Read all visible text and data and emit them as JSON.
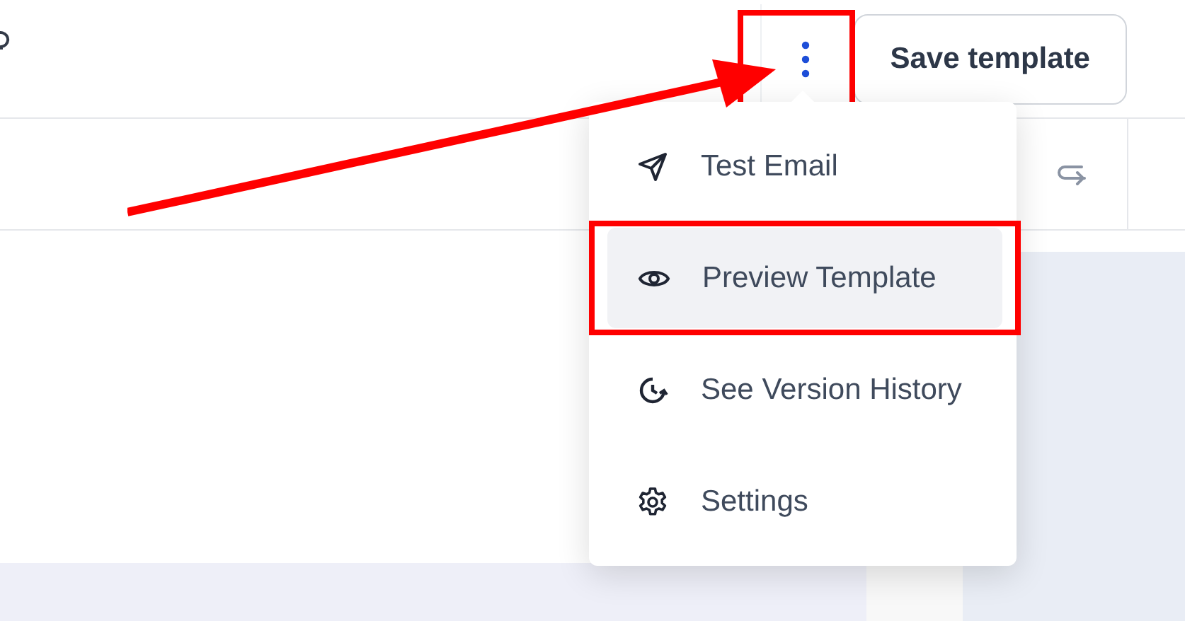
{
  "more_button": {
    "highlighted": true
  },
  "save_button": {
    "label": "Save template"
  },
  "menu": {
    "items": [
      {
        "kind": "send",
        "label": "Test Email",
        "selected": false,
        "highlighted": false
      },
      {
        "kind": "eye",
        "label": "Preview Template",
        "selected": true,
        "highlighted": true
      },
      {
        "kind": "history",
        "label": "See Version History",
        "selected": false,
        "highlighted": false
      },
      {
        "kind": "gear",
        "label": "Settings",
        "selected": false,
        "highlighted": false
      }
    ]
  }
}
